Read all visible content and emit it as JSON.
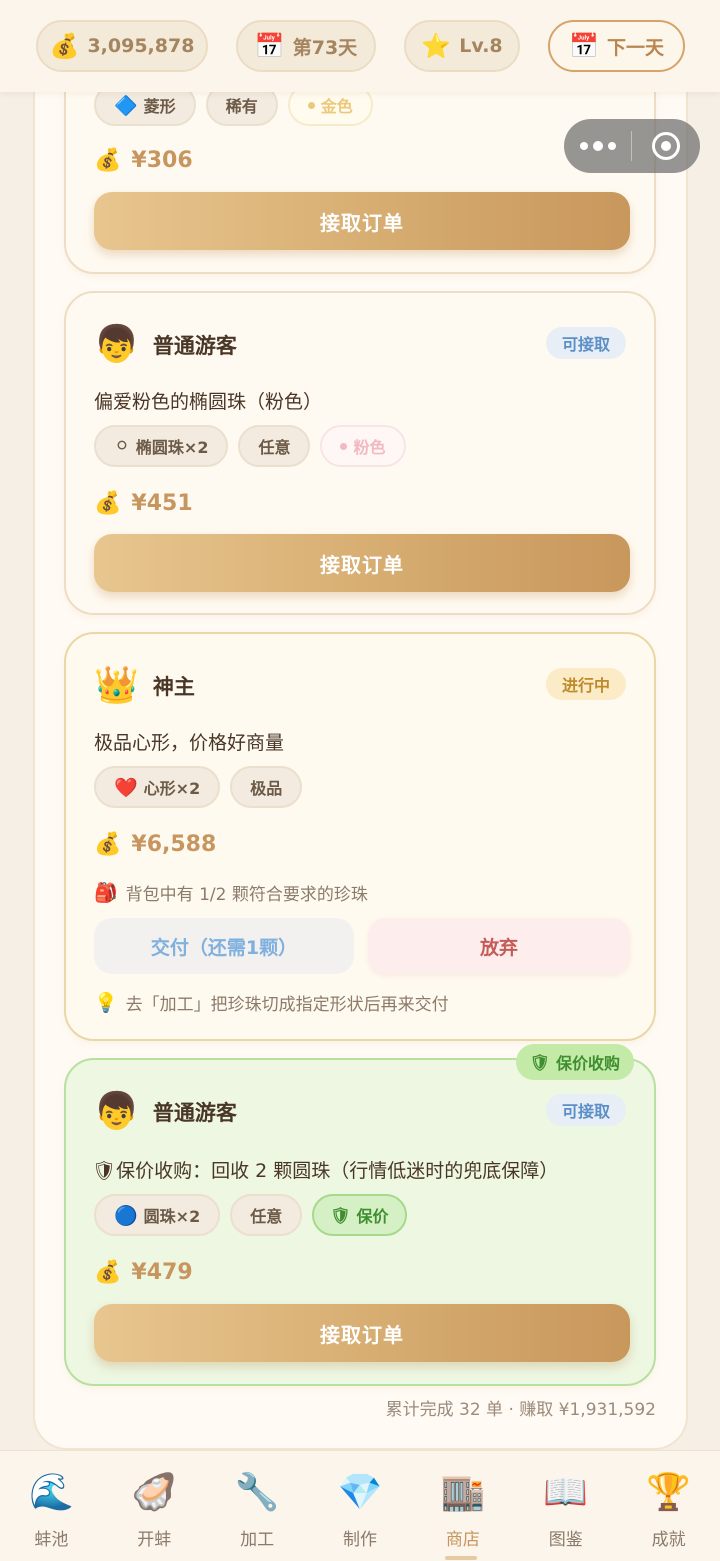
{
  "topbar": {
    "coins_icon": "money-bag-icon",
    "coins": "3,095,878",
    "day_icon": "calendar-icon",
    "day": "第73天",
    "level_icon": "star-icon",
    "level": "Lv.8",
    "next_icon": "calendar-icon",
    "next_day_label": "下一天"
  },
  "orders": [
    {
      "tags": [
        {
          "icon": "🔷",
          "label": "菱形"
        },
        {
          "icon": "",
          "label": "稀有"
        },
        {
          "icon": "•",
          "label": "金色"
        }
      ],
      "price": "¥306",
      "button": "接取订单"
    },
    {
      "customer": "普通游客",
      "status": "可接取",
      "description": "偏爱粉色的椭圆珠（粉色）",
      "tags": [
        {
          "icon": "⚪",
          "label": "椭圆珠×2"
        },
        {
          "icon": "",
          "label": "任意"
        },
        {
          "icon": "•",
          "label": "粉色"
        }
      ],
      "price": "¥451",
      "button": "接取订单"
    },
    {
      "customer": "神主",
      "status": "进行中",
      "description": "极品心形，价格好商量",
      "tags": [
        {
          "icon": "❤️",
          "label": "心形×2"
        },
        {
          "icon": "",
          "label": "极品"
        }
      ],
      "price": "¥6,588",
      "backpack_hint": "背包中有 1/2 颗符合要求的珍珠",
      "deliver_button": "交付（还需1颗）",
      "abandon_button": "放弃",
      "tip": "去「加工」把珍珠切成指定形状后再来交付"
    },
    {
      "ribbon": "保价收购",
      "customer": "普通游客",
      "status": "可接取",
      "description": "保价收购：回收 2 颗圆珠（行情低迷时的兜底保障）",
      "tags": [
        {
          "icon": "🔵",
          "label": "圆珠×2"
        },
        {
          "icon": "",
          "label": "任意"
        },
        {
          "icon": "🛡",
          "label": "保价"
        }
      ],
      "price": "¥479",
      "button": "接取订单"
    }
  ],
  "summary": "累计完成 32 单 · 赚取 ¥1,931,592",
  "nav": [
    {
      "icon": "🌊",
      "label": "蚌池"
    },
    {
      "icon": "🦪",
      "label": "开蚌"
    },
    {
      "icon": "🔧",
      "label": "加工"
    },
    {
      "icon": "💎",
      "label": "制作"
    },
    {
      "icon": "🏬",
      "label": "商店"
    },
    {
      "icon": "📖",
      "label": "图鉴"
    },
    {
      "icon": "🏆",
      "label": "成就"
    }
  ],
  "colors": {
    "accent": "#d6ac70",
    "status_open": "#5c8fc7",
    "status_progress": "#bf8a2a",
    "guarantee_bg": "#edf7e2",
    "abandon": "#c55a56"
  }
}
